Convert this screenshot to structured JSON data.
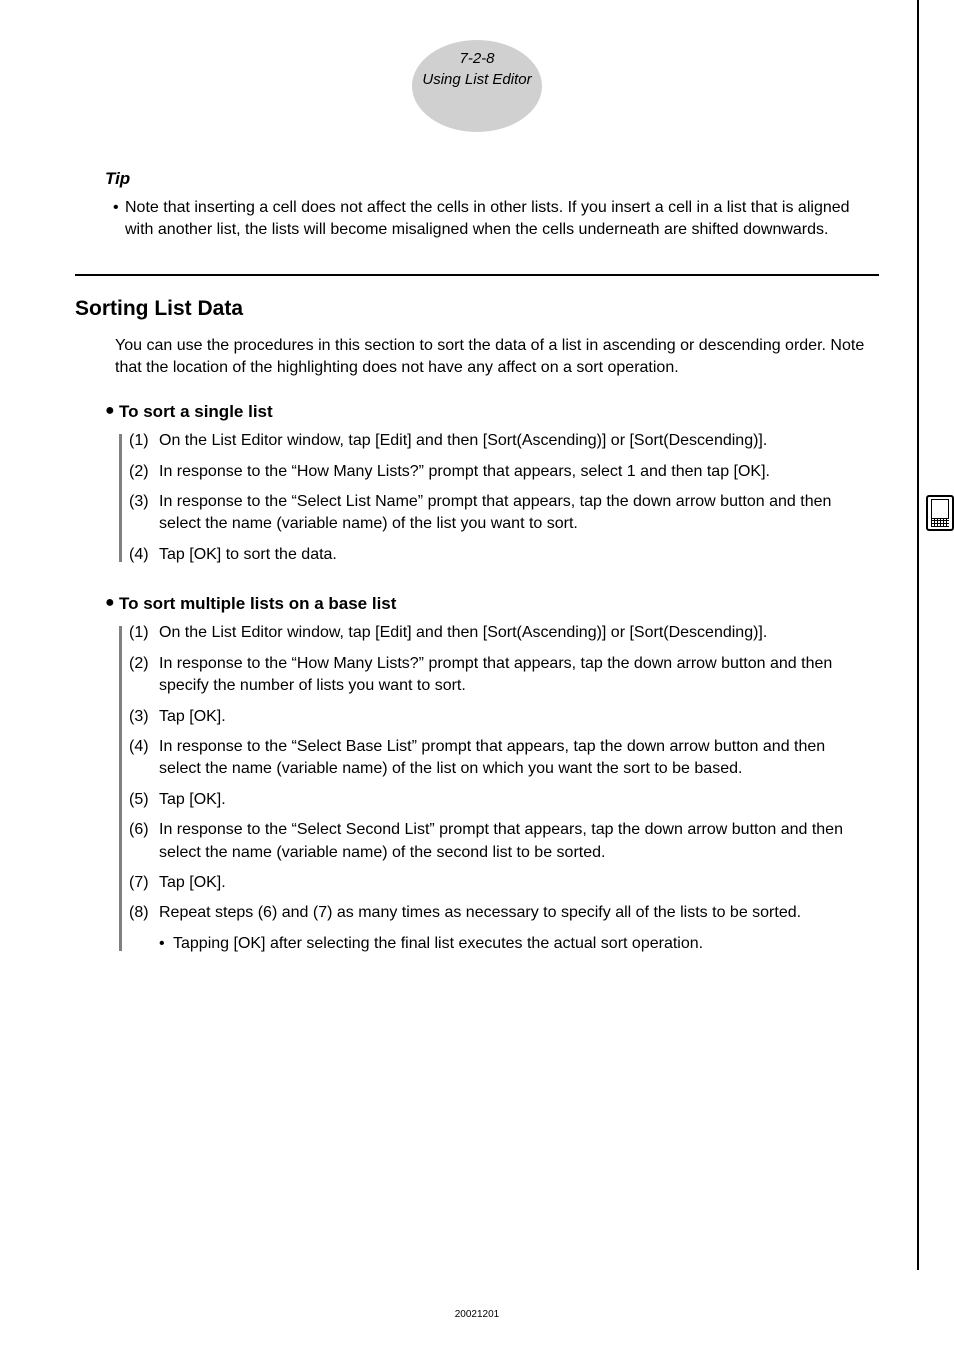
{
  "header": {
    "pageNum": "7-2-8",
    "title": "Using List Editor"
  },
  "tip": {
    "heading": "Tip",
    "body": "Note that inserting a cell does not affect the cells in other lists. If you insert a cell in a list that is aligned with another list, the lists will become misaligned when the cells underneath are shifted downwards."
  },
  "section": {
    "title": "Sorting List Data",
    "intro": "You can use the procedures in this section to sort the data of a list in ascending or descending order. Note that the location of the highlighting does not have any affect on a sort operation."
  },
  "sub1": {
    "title": "To sort a single list",
    "steps": [
      {
        "n": "(1)",
        "t": "On the List Editor window, tap [Edit] and then [Sort(Ascending)] or [Sort(Descending)]."
      },
      {
        "n": "(2)",
        "t": "In response to the “How Many Lists?” prompt that appears, select 1 and then tap [OK]."
      },
      {
        "n": "(3)",
        "t": "In response to the “Select List Name” prompt that appears, tap the down arrow button and then select the name (variable name) of the list you want to sort."
      },
      {
        "n": "(4)",
        "t": "Tap [OK] to sort the data."
      }
    ]
  },
  "sub2": {
    "title": "To sort multiple lists on a base list",
    "steps": [
      {
        "n": "(1)",
        "t": "On the List Editor window, tap [Edit] and then [Sort(Ascending)] or [Sort(Descending)]."
      },
      {
        "n": "(2)",
        "t": "In response to the “How Many Lists?” prompt that appears, tap the down arrow button and then specify the number of lists you want to sort."
      },
      {
        "n": "(3)",
        "t": "Tap [OK]."
      },
      {
        "n": "(4)",
        "t": "In response to the “Select Base List” prompt that appears, tap the down arrow button and then select the name (variable name) of the list on which you want the sort to be based."
      },
      {
        "n": "(5)",
        "t": "Tap [OK]."
      },
      {
        "n": "(6)",
        "t": "In response to the “Select Second List” prompt that appears, tap the down arrow button and then select the name (variable name) of the second list to be sorted."
      },
      {
        "n": "(7)",
        "t": "Tap [OK]."
      },
      {
        "n": "(8)",
        "t": "Repeat steps (6) and (7) as many times as necessary to specify all of the lists to be sorted."
      }
    ],
    "note": "Tapping [OK] after selecting the final list executes the actual sort operation."
  },
  "footer": {
    "code": "20021201"
  }
}
